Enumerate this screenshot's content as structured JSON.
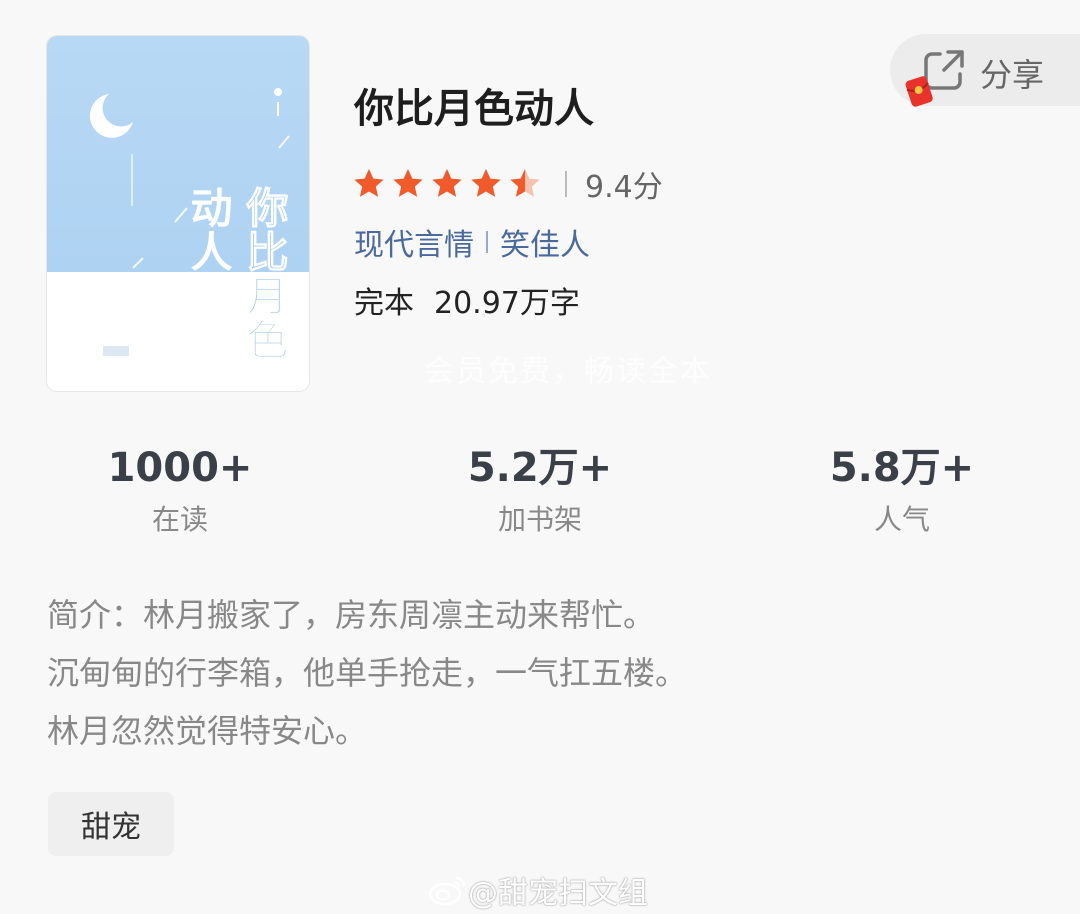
{
  "book": {
    "title": "你比月色动人",
    "score": "9.4分",
    "rating": 4.5,
    "category": "现代言情",
    "author": "笑佳人",
    "status": "完本",
    "word_count": "20.97万字",
    "overlay_text": "会员免费，畅读全本"
  },
  "cover": {
    "title_line1": "你比月色",
    "title_line2": "动人"
  },
  "share": {
    "label": "分享"
  },
  "stats": [
    {
      "value": "1000+",
      "label": "在读"
    },
    {
      "value": "5.2万+",
      "label": "加书架"
    },
    {
      "value": "5.8万+",
      "label": "人气"
    }
  ],
  "description": {
    "lines": [
      "简介：林月搬家了，房东周凛主动来帮忙。",
      "沉甸甸的行李箱，他单手抢走，一气扛五楼。",
      "林月忽然觉得特安心。"
    ]
  },
  "tags": [
    "甜宠"
  ],
  "watermark": {
    "text": "@甜宠扫文组"
  },
  "colors": {
    "star": "#f15a2b",
    "link": "#4a6a9e",
    "cover_sky": "#b8d9f5"
  }
}
